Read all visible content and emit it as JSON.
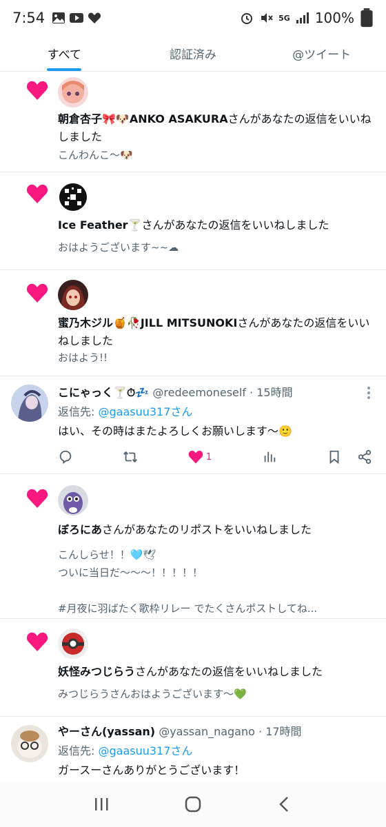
{
  "status": {
    "time": "7:54",
    "battery": "100%",
    "network": "5G"
  },
  "tabs": [
    {
      "label": "すべて",
      "active": true
    },
    {
      "label": "認証済み",
      "active": false
    },
    {
      "label": "@ツイート",
      "active": false
    }
  ],
  "notifications": [
    {
      "name": "朝倉杏子🎀🐶ANKO ASAKURA",
      "action": "さんがあなたの返信をいいねしました",
      "preview": "こんわんこ〜🐶"
    },
    {
      "name": "Ice Feather🍸",
      "action": "さんがあなたの返信をいいねしました",
      "preview": "おはようございます~~☁"
    },
    {
      "name": "蜜乃木ジル🍯🥀JILL MITSUNOKI",
      "action": "さんがあなたの返信をいいねしました",
      "preview": "おはよう!!"
    }
  ],
  "tweet1": {
    "name": "こにゃっく🍸⏱💤",
    "handle": "@redeemoneself",
    "time": "· 15時間",
    "reply_prefix": "返信先: ",
    "reply_to": "@gaasuu317さん",
    "body": "はい、その時はまたよろしくお願いします〜🙂",
    "like_count": "1"
  },
  "notifications2": [
    {
      "name": "ぼろにあ",
      "action": "さんがあなたのリポストをいいねしました",
      "preview_line1": "こんしらせ！！🩵🕊",
      "preview_line2": "ついに当日だ〜〜〜！！！！！",
      "preview_line3": "#月夜に羽ばたく歌枠リレー でたくさんポストしてね..."
    },
    {
      "name": "妖怪みつじらう",
      "action": "さんがあなたの返信をいいねしました",
      "preview": "みつじらうさんおはようございます〜💚"
    }
  ],
  "tweet2": {
    "name": "やーさん(yassan)",
    "handle": "@yassan_nagano",
    "time": "· 17時間",
    "reply_prefix": "返信先: ",
    "reply_to": "@gaasuu317さん",
    "body": "ガースーさんありがとうございます！"
  },
  "colors": {
    "heart": "#f91880",
    "accent": "#1d9bf0",
    "muted": "#536471"
  }
}
